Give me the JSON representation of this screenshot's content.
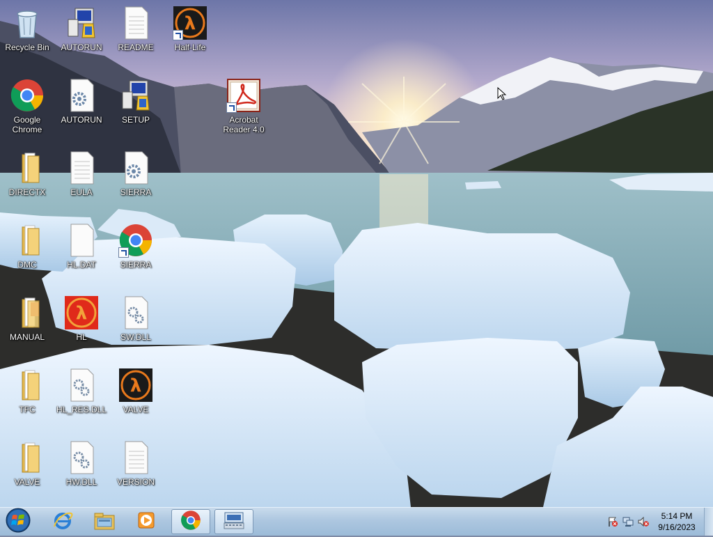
{
  "desktop": {
    "icons": [
      {
        "label": "Recycle Bin",
        "icon": "recycle-bin-icon"
      },
      {
        "label": "AUTORUN",
        "icon": "setup-app-icon"
      },
      {
        "label": "README",
        "icon": "text-file-icon"
      },
      {
        "label": "Half-Life",
        "icon": "half-life-icon"
      },
      {
        "label": "Google Chrome",
        "icon": "chrome-icon"
      },
      {
        "label": "AUTORUN",
        "icon": "settings-file-icon"
      },
      {
        "label": "SETUP",
        "icon": "setup-app-icon"
      },
      {
        "label": "Acrobat Reader 4.0",
        "icon": "acrobat-icon"
      },
      {
        "label": "DIRECTX",
        "icon": "folder-icon"
      },
      {
        "label": "EULA",
        "icon": "text-file-icon"
      },
      {
        "label": "SIERRA",
        "icon": "settings-file-icon"
      },
      {
        "label": "DMC",
        "icon": "folder-icon"
      },
      {
        "label": "HL.DAT",
        "icon": "blank-file-icon"
      },
      {
        "label": "SIERRA",
        "icon": "chrome-icon"
      },
      {
        "label": "MANUAL",
        "icon": "folder-icon"
      },
      {
        "label": "HL",
        "icon": "half-life-icon"
      },
      {
        "label": "SW.DLL",
        "icon": "dll-file-icon"
      },
      {
        "label": "TFC",
        "icon": "folder-icon"
      },
      {
        "label": "HL_RES.DLL",
        "icon": "dll-file-icon"
      },
      {
        "label": "VALVE",
        "icon": "half-life-icon"
      },
      {
        "label": "VALVE",
        "icon": "folder-icon"
      },
      {
        "label": "HW.DLL",
        "icon": "dll-file-icon"
      },
      {
        "label": "VERSION",
        "icon": "text-file-icon"
      }
    ]
  },
  "taskbar": {
    "start": {
      "icon": "windows-start-icon"
    },
    "pinned": [
      {
        "icon": "internet-explorer-icon",
        "active": false
      },
      {
        "icon": "file-explorer-icon",
        "active": false
      },
      {
        "icon": "media-player-icon",
        "active": false
      },
      {
        "icon": "chrome-icon",
        "active": true
      },
      {
        "icon": "on-screen-keyboard-icon",
        "active": true
      }
    ],
    "tray": {
      "icons": [
        "action-center-flag-icon",
        "network-icon",
        "volume-muted-icon"
      ],
      "time": "5:14 PM",
      "date": "9/16/2023"
    }
  },
  "colors": {
    "taskbar": "#adc7e0",
    "sky": "#9a9cc4",
    "water": "#8fb2bd",
    "ice": "#dbe9f7"
  }
}
